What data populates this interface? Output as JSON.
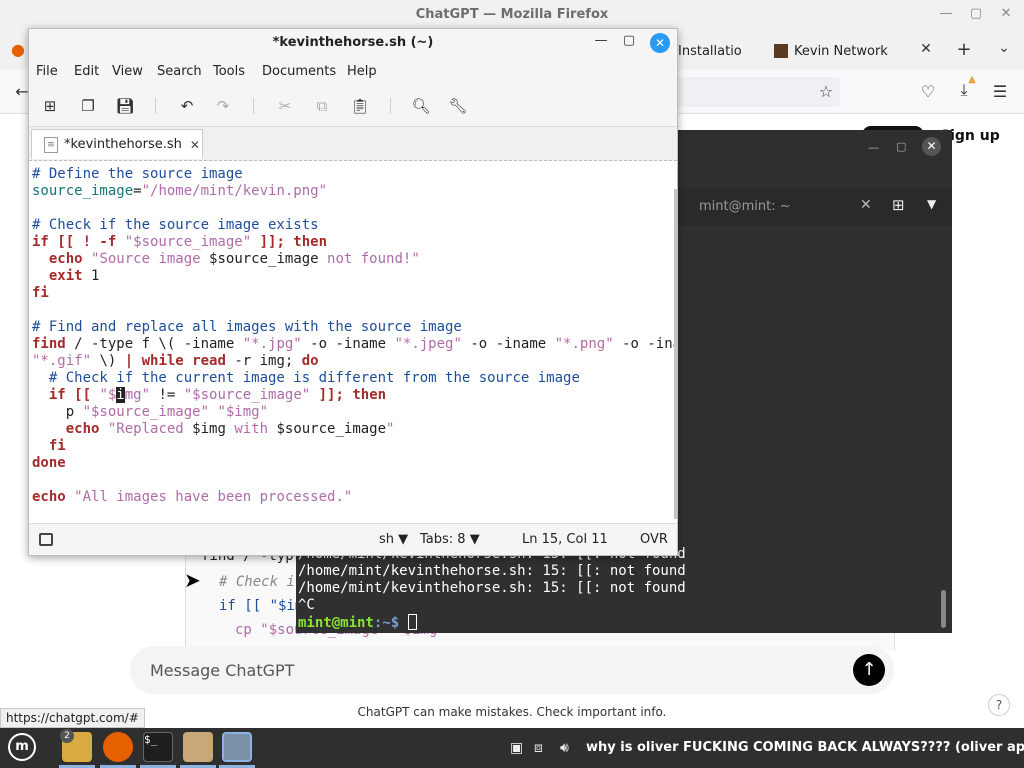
{
  "firefox": {
    "window_title": "ChatGPT — Mozilla Firefox",
    "tabs": [
      {
        "label": "Installatio"
      },
      {
        "label": "Kevin Network"
      }
    ],
    "signup_label": "Sign up",
    "chat_code": [
      "find / -typ",
      "# Check i",
      "if [[ \"$im",
      "cp \"$source_image\" \"$img\""
    ],
    "message_placeholder": "Message ChatGPT",
    "disclaimer": "ChatGPT can make mistakes. Check important info.",
    "help_label": "?",
    "status_url": "https://chatgpt.com/#"
  },
  "terminal": {
    "tab_label": "mint@mint: ~",
    "output": [
      "/home/mint/kevinthehorse.sh: 15: [[: not found",
      "/home/mint/kevinthehorse.sh: 15: [[: not found",
      "/home/mint/kevinthehorse.sh: 15: [[: not found",
      "^C"
    ],
    "prompt_user": "mint@mint",
    "prompt_path": ":~$ "
  },
  "gedit": {
    "window_title": "*kevinthehorse.sh (~)",
    "menu": [
      "File",
      "Edit",
      "View",
      "Search",
      "Tools",
      "Documents",
      "Help"
    ],
    "tab_label": "*kevinthehorse.sh",
    "status": {
      "language": "sh",
      "tabs": "Tabs: 8",
      "position": "Ln 15, Col 11",
      "mode": "OVR"
    }
  },
  "taskbar": {
    "files_badge": "2",
    "terminal_glyph": "$_",
    "tray_text": "why is oliver FUCKING COMING BACK ALWAYS???? (oliver appears)"
  },
  "colors": {
    "gedit_close": "#2b9af3",
    "terminal_bg": "#303030",
    "taskbar_bg": "#2f2f2f",
    "prompt_green": "#8ae234"
  }
}
